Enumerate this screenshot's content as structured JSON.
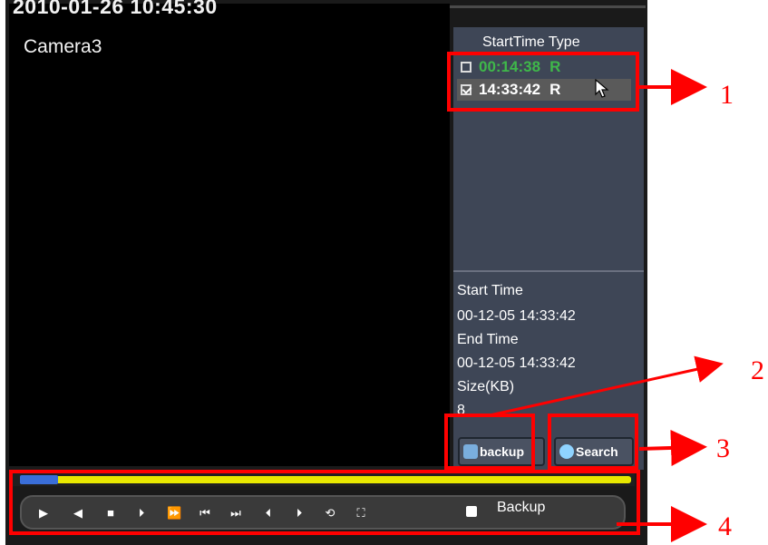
{
  "osd": {
    "datetime": "2010-01-26 10:45:30",
    "camera": "Camera3"
  },
  "file_list": {
    "header": "StartTime Type",
    "rows": [
      {
        "time": "00:14:38",
        "type": "R",
        "checked": false,
        "color": "#3fb84a"
      },
      {
        "time": "14:33:42",
        "type": "R",
        "checked": true,
        "selected": true
      }
    ]
  },
  "info": {
    "start_label": "Start Time",
    "start_value": "00-12-05 14:33:42",
    "end_label": "End Time",
    "end_value": "00-12-05 14:33:42",
    "size_label": "Size(KB)",
    "size_value": "8"
  },
  "buttons": {
    "backup": "backup",
    "search": "Search"
  },
  "playback": {
    "backup_label": "Backup"
  },
  "annotations": [
    "1",
    "2",
    "3",
    "4"
  ],
  "colors": {
    "annotation": "#ff0000",
    "progress": "#e8e800",
    "progress_marker": "#3a6ed8",
    "side_panel": "#3e4656"
  }
}
